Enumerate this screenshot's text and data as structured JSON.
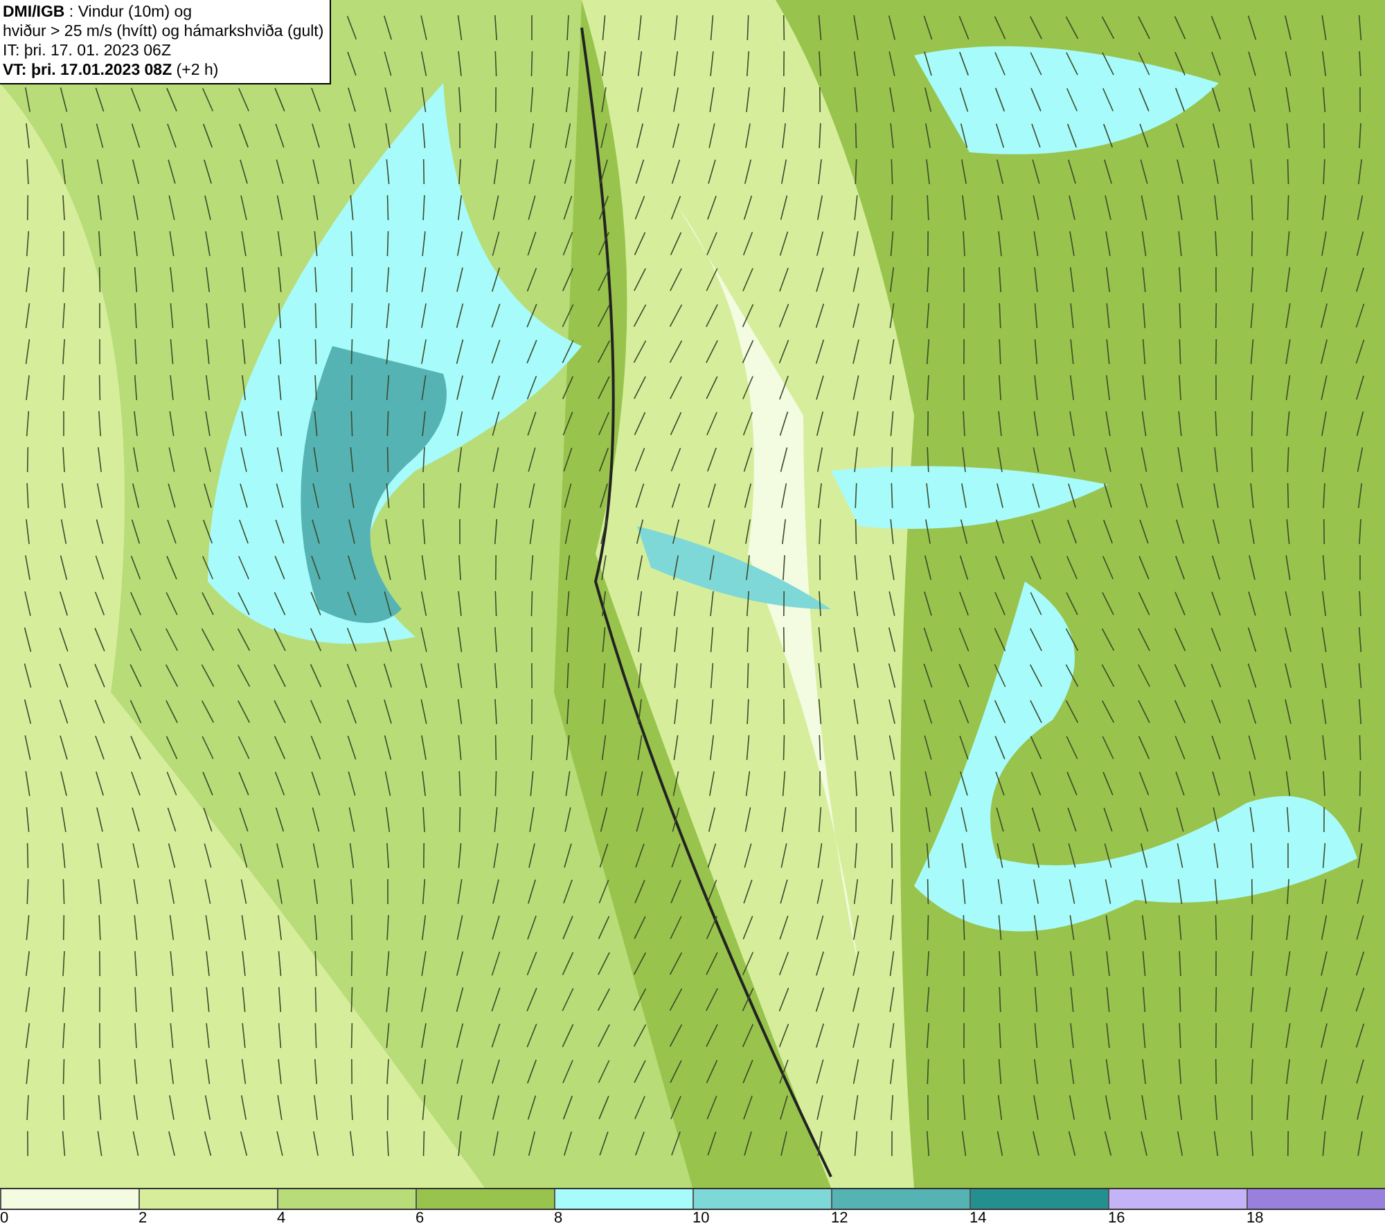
{
  "title_box": {
    "lines": [
      "**DMI/IGB** : Vindur (10m) og",
      "hviður > 25 m/s (hvítt) og hámarkshviða (gult)",
      "IT: þri. 17. 01. 2023 06Z",
      "**VT: þri. 17.01.2023 08Z** (+2 h)"
    ]
  },
  "legend": [
    {
      "label": "0",
      "color": "#f3fbe0"
    },
    {
      "label": "2",
      "color": "#d6ee9c"
    },
    {
      "label": "4",
      "color": "#b8dc78"
    },
    {
      "label": "6",
      "color": "#98c34c"
    },
    {
      "label": "8",
      "color": "#a8fbfb"
    },
    {
      "label": "10",
      "color": "#7fd8d8"
    },
    {
      "label": "12",
      "color": "#55b3b3"
    },
    {
      "label": "14",
      "color": "#248f8f"
    },
    {
      "label": "16",
      "color": "#c5b3f8"
    },
    {
      "label": "18",
      "color": "#9a80dd"
    }
  ]
}
